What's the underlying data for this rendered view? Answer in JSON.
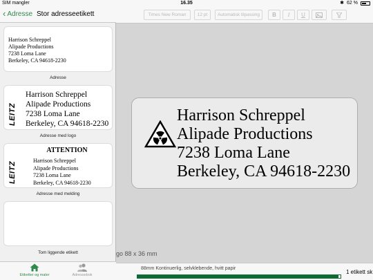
{
  "status_bar": {
    "carrier": "SIM mangler",
    "time": "16.35",
    "battery": "62 %",
    "battery_level": 0.62
  },
  "sidebar": {
    "back_label": "Adresse",
    "title": "Stor adresseetikett",
    "templates": [
      {
        "caption": "Adresse",
        "lines": [
          "Harrison Schreppel",
          "Alipade Productions",
          "7238 Loma Lane",
          "Berkeley, CA 94618-2230"
        ]
      },
      {
        "caption": "Adresse med logo",
        "logo": "LEITZ",
        "lines": [
          "Harrison Schreppel",
          "Alipade Productions",
          "7238 Loma Lane",
          "Berkeley, CA 94618-2230"
        ]
      },
      {
        "caption": "Adresse med melding",
        "logo": "LEITZ",
        "heading": "ATTENTION",
        "lines": [
          "Harrison Schreppel",
          "Alipade Productions",
          "7238 Loma Lane",
          "Berkeley, CA 94618-2230"
        ]
      },
      {
        "caption": "Tom liggende etikett"
      }
    ],
    "tabs": [
      {
        "label": "Etiketter og maler",
        "icon": "home-icon",
        "active": true
      },
      {
        "label": "Adressebok",
        "icon": "contacts-icon",
        "active": false
      }
    ]
  },
  "toolbar": {
    "font": "Times New Roman",
    "size": "12 pt",
    "fit": "Automatisk tilpassing",
    "bold": "B",
    "italic": "I",
    "underline": "U",
    "image_icon": "image-icon",
    "align_icon": "align-icon"
  },
  "label": {
    "lines": [
      "Harrison Schreppel",
      "Alipade Productions",
      "7238 Loma Lane",
      "Berkeley, CA 94618-2230"
    ],
    "icon": "radiation-warning-icon",
    "size_text": "go 88 x 36 mm"
  },
  "bottom_bar": {
    "media": "88mm Kontinuerlig, selvklebende, hvitt papir",
    "progress": 0.99,
    "count": "1 etikett sk"
  },
  "colors": {
    "accent": "#2f8a4c",
    "progress": "#0e6b34"
  }
}
